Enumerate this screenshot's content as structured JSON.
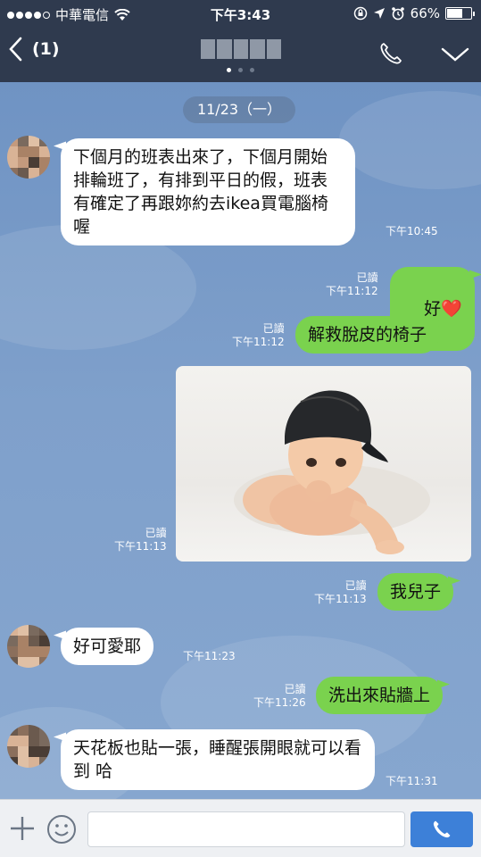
{
  "status_bar": {
    "carrier": "中華電信",
    "time": "下午3:43",
    "battery": "66%",
    "battery_level": 0.66
  },
  "header": {
    "back_count": "(1)",
    "call_icon": "phone-icon",
    "menu_icon": "chevron-down-icon"
  },
  "chat": {
    "date_label": "11/23（一）",
    "messages": [
      {
        "side": "in",
        "text": "下個月的班表出來了，下個月開始排輪班了，有排到平日的假，班表有確定了再跟妳約去ikea買電腦椅喔",
        "time": "下午10:45"
      },
      {
        "side": "out",
        "text": "好",
        "emoji": "❤️",
        "read": "已讀",
        "time": "下午11:12"
      },
      {
        "side": "out",
        "text": "解救脫皮的椅子",
        "read": "已讀",
        "time": "下午11:12"
      },
      {
        "side": "out",
        "type": "image",
        "read": "已讀",
        "time": "下午11:13"
      },
      {
        "side": "out",
        "text": "我兒子",
        "read": "已讀",
        "time": "下午11:13"
      },
      {
        "side": "in",
        "text": "好可愛耶",
        "time": "下午11:23"
      },
      {
        "side": "out",
        "text": "洗出來貼牆上",
        "read": "已讀",
        "time": "下午11:26"
      },
      {
        "side": "in",
        "text": "天花板也貼一張，睡醒張開眼就可以看到 哈",
        "time": "下午11:31"
      }
    ]
  },
  "input_bar": {
    "placeholder": "",
    "plus_icon": "plus-icon",
    "emoji_icon": "smiley-icon",
    "send_icon": "phone-icon"
  },
  "colors": {
    "header_bg": "#2f3a4e",
    "chat_bg": "#7b9cc9",
    "outgoing_bubble": "#7ad24e",
    "incoming_bubble": "#ffffff",
    "send_button": "#3d80d8"
  }
}
